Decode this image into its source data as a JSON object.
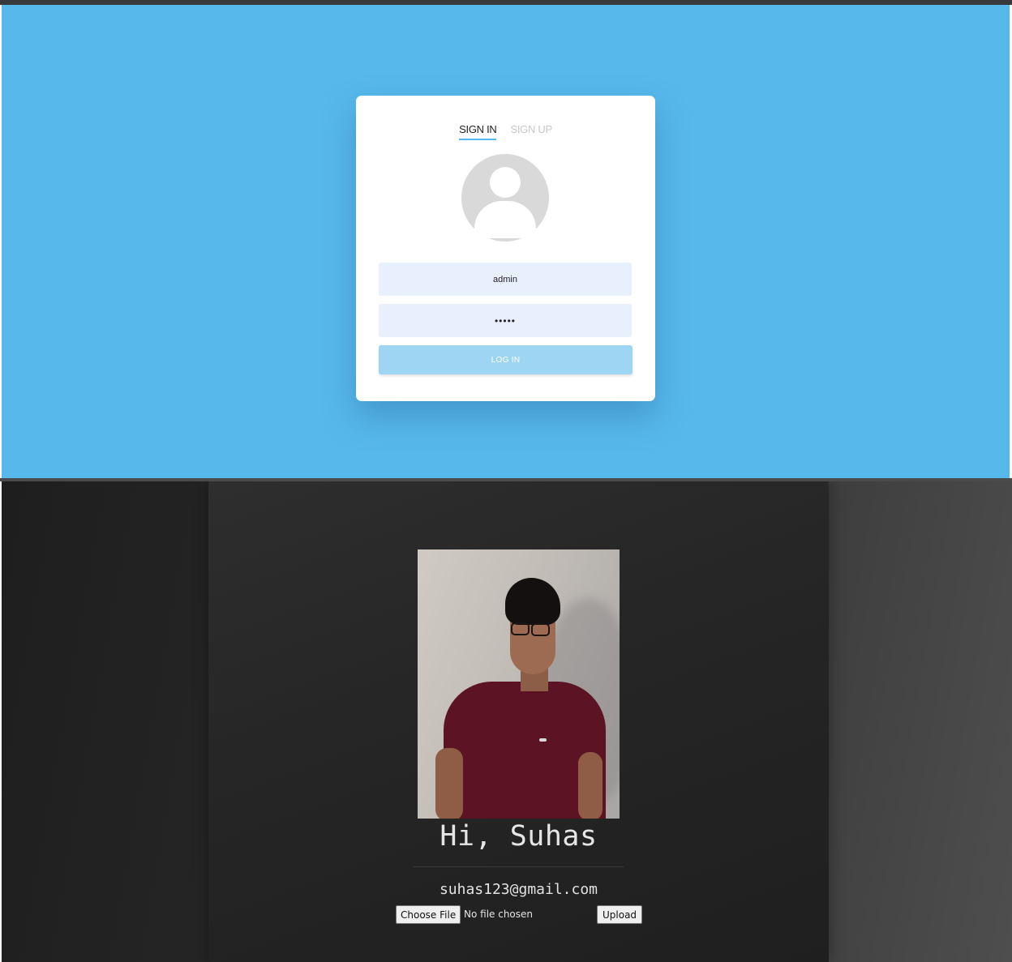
{
  "login": {
    "tabs": [
      {
        "label": "SIGN IN",
        "active": true
      },
      {
        "label": "SIGN UP",
        "active": false
      }
    ],
    "username_value": "admin",
    "password_value": "admin",
    "login_button_label": "LOG IN",
    "colors": {
      "background": "#57b8eb",
      "field": "#e8f0fe",
      "button": "#9dd5f3"
    }
  },
  "profile": {
    "photo_alt": "profile-photo",
    "greeting": "Hi, Suhas",
    "email": "suhas123@gmail.com",
    "choose_file_label": "Choose File",
    "file_status": "No file chosen",
    "upload_label": "Upload"
  }
}
